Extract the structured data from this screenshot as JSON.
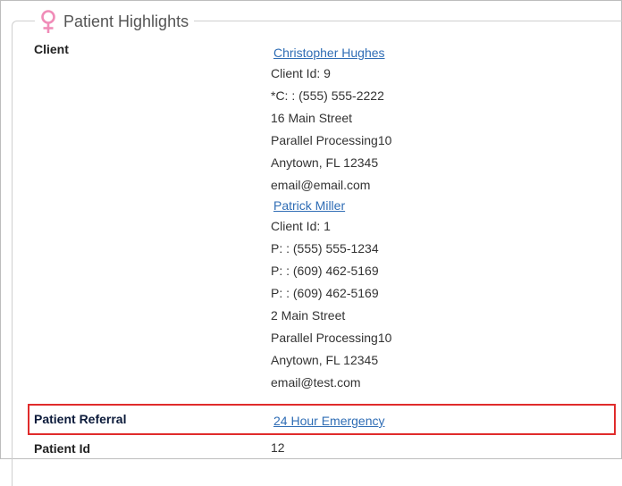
{
  "panel": {
    "title": "Patient Highlights",
    "icon": "female-symbol-icon",
    "icon_color": "#f08cb8"
  },
  "client_section": {
    "label": "Client",
    "clients": [
      {
        "name": "Christopher Hughes",
        "client_id": "Client Id: 9",
        "phones": [
          "*C: : (555) 555-2222"
        ],
        "address": [
          "16 Main Street",
          "Parallel Processing10",
          "Anytown, FL 12345"
        ],
        "email": "email@email.com"
      },
      {
        "name": "Patrick Miller",
        "client_id": "Client Id: 1",
        "phones": [
          "P: : (555) 555-1234",
          "P: : (609) 462-5169",
          "P: : (609) 462-5169"
        ],
        "address": [
          "2 Main Street",
          "Parallel Processing10",
          "Anytown, FL 12345"
        ],
        "email": "email@test.com"
      }
    ]
  },
  "referral": {
    "label": "Patient Referral",
    "value": "24 Hour Emergency",
    "highlight_color": "#e02b2b"
  },
  "patient_id": {
    "label": "Patient Id",
    "value": "12"
  }
}
